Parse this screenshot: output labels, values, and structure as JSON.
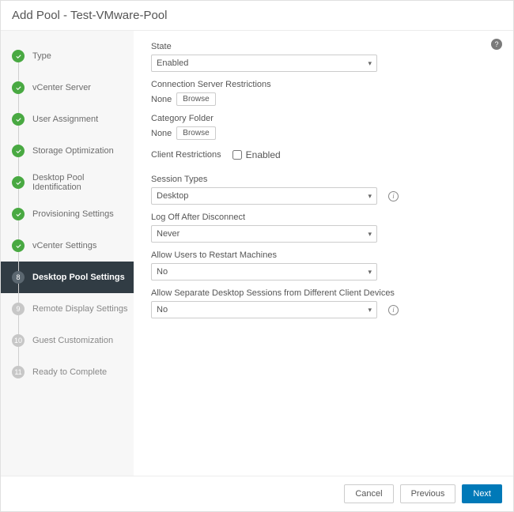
{
  "header": {
    "title": "Add Pool - Test-VMware-Pool"
  },
  "sidebar": {
    "steps": [
      {
        "label": "Type",
        "state": "done"
      },
      {
        "label": "vCenter Server",
        "state": "done"
      },
      {
        "label": "User Assignment",
        "state": "done"
      },
      {
        "label": "Storage Optimization",
        "state": "done"
      },
      {
        "label": "Desktop Pool Identification",
        "state": "done"
      },
      {
        "label": "Provisioning Settings",
        "state": "done"
      },
      {
        "label": "vCenter Settings",
        "state": "done"
      },
      {
        "label": "Desktop Pool Settings",
        "state": "current",
        "num": "8"
      },
      {
        "label": "Remote Display Settings",
        "state": "future",
        "num": "9"
      },
      {
        "label": "Guest Customization",
        "state": "future",
        "num": "10"
      },
      {
        "label": "Ready to Complete",
        "state": "future",
        "num": "11"
      }
    ]
  },
  "main": {
    "state_label": "State",
    "state_value": "Enabled",
    "csr_label": "Connection Server Restrictions",
    "csr_value": "None",
    "browse_label": "Browse",
    "cat_label": "Category Folder",
    "cat_value": "None",
    "client_restrictions_label": "Client Restrictions",
    "client_restrictions_cb_label": "Enabled",
    "session_label": "Session Types",
    "session_value": "Desktop",
    "logoff_label": "Log Off After Disconnect",
    "logoff_value": "Never",
    "restart_label": "Allow Users to Restart Machines",
    "restart_value": "No",
    "separate_label": "Allow Separate Desktop Sessions from Different Client Devices",
    "separate_value": "No"
  },
  "footer": {
    "cancel": "Cancel",
    "previous": "Previous",
    "next": "Next"
  }
}
